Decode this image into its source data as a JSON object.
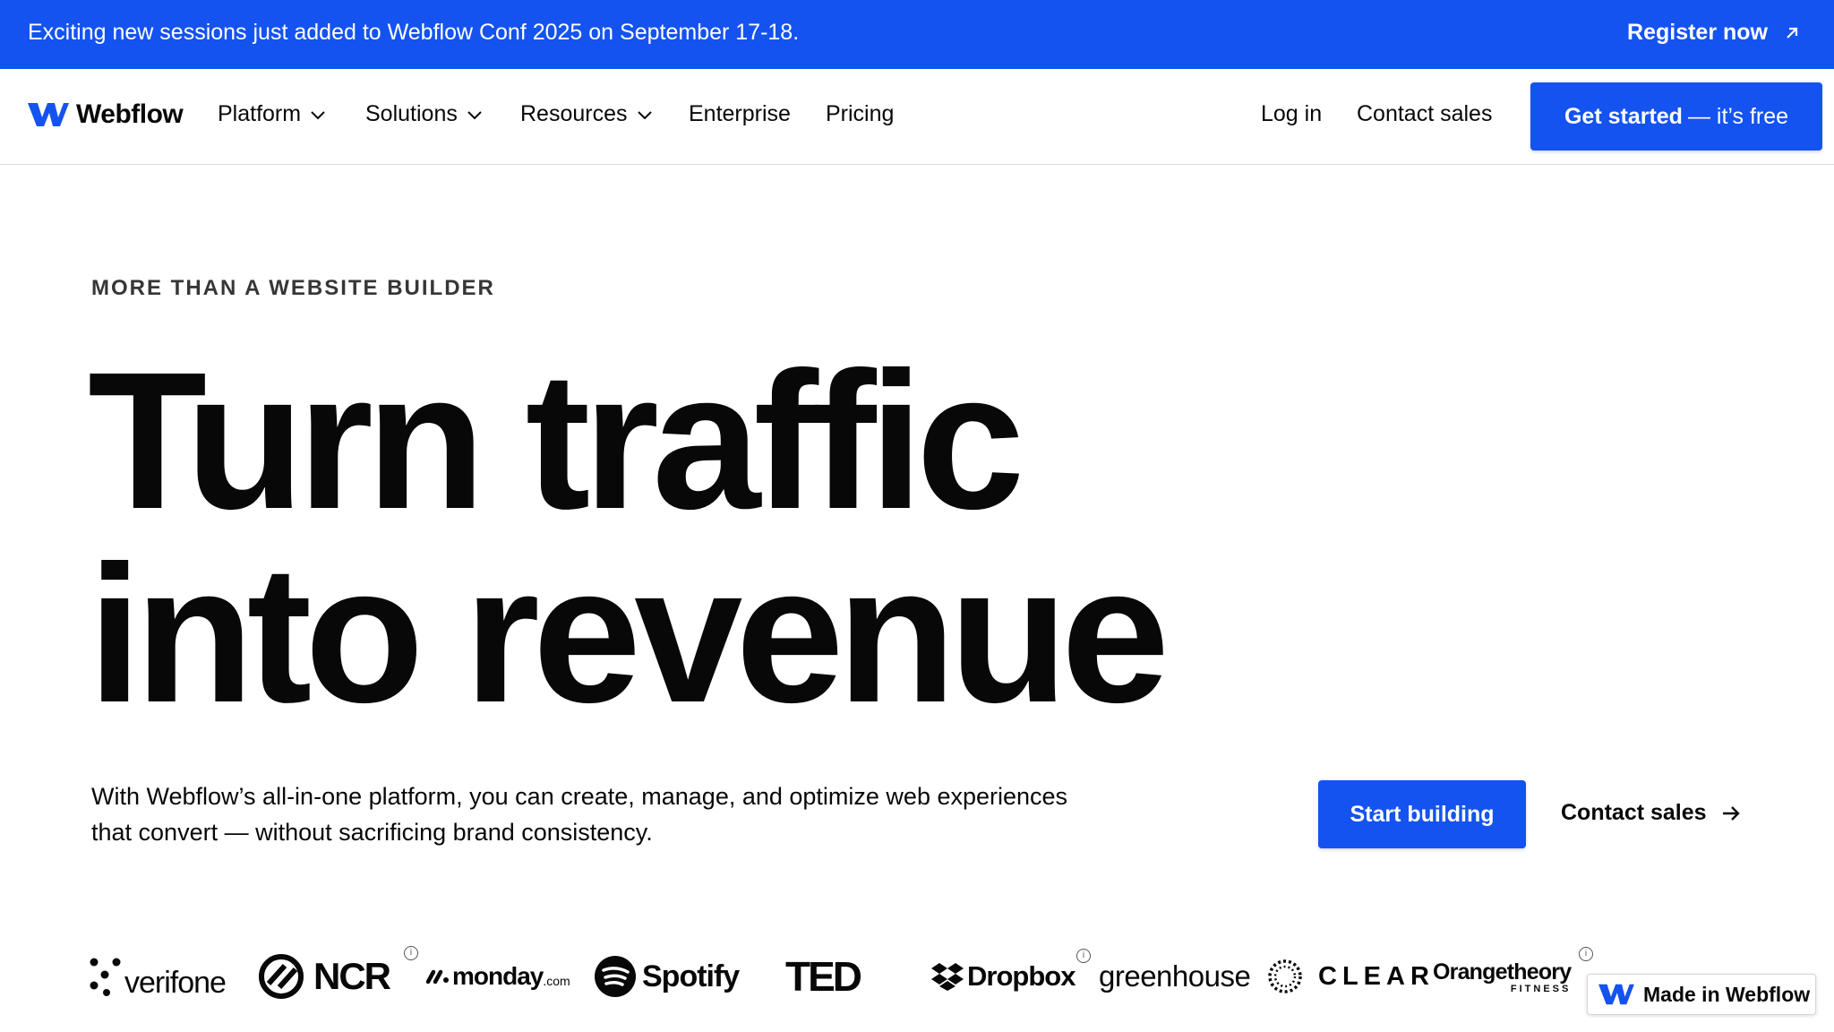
{
  "banner": {
    "text": "Exciting new sessions just added to Webflow Conf 2025 on September 17-18.",
    "cta": "Register now",
    "cta_icon": "arrow-up-right-icon",
    "bg_color": "#1453f0"
  },
  "nav": {
    "brand": "Webflow",
    "items": [
      {
        "label": "Platform",
        "has_dropdown": true
      },
      {
        "label": "Solutions",
        "has_dropdown": true
      },
      {
        "label": "Resources",
        "has_dropdown": true
      },
      {
        "label": "Enterprise",
        "has_dropdown": false
      },
      {
        "label": "Pricing",
        "has_dropdown": false
      }
    ],
    "login": "Log in",
    "contact": "Contact sales",
    "cta_bold": "Get started",
    "cta_light": "— it’s free"
  },
  "hero": {
    "eyebrow": "MORE THAN A WEBSITE BUILDER",
    "headline_line1": "Turn traffic",
    "headline_line2": "into revenue",
    "subtitle": "With Webflow’s all-in-one platform, you can create, manage, and optimize web experiences that convert — without sacrificing brand consistency.",
    "primary_cta": "Start building",
    "secondary_cta": "Contact sales"
  },
  "logos": {
    "verifone": "verifone",
    "ncr": "NCR",
    "monday": "monday",
    "monday_suffix": ".com",
    "spotify": "Spotify",
    "ted": "TED",
    "dropbox": "Dropbox",
    "greenhouse": "greenhouse",
    "clear": "CLEAR",
    "orangetheory": "Orangetheory",
    "orangetheory_sub": "FITNESS"
  },
  "badge": {
    "text": "Made in Webflow"
  },
  "colors": {
    "accent": "#1453f0",
    "text": "#080808"
  }
}
